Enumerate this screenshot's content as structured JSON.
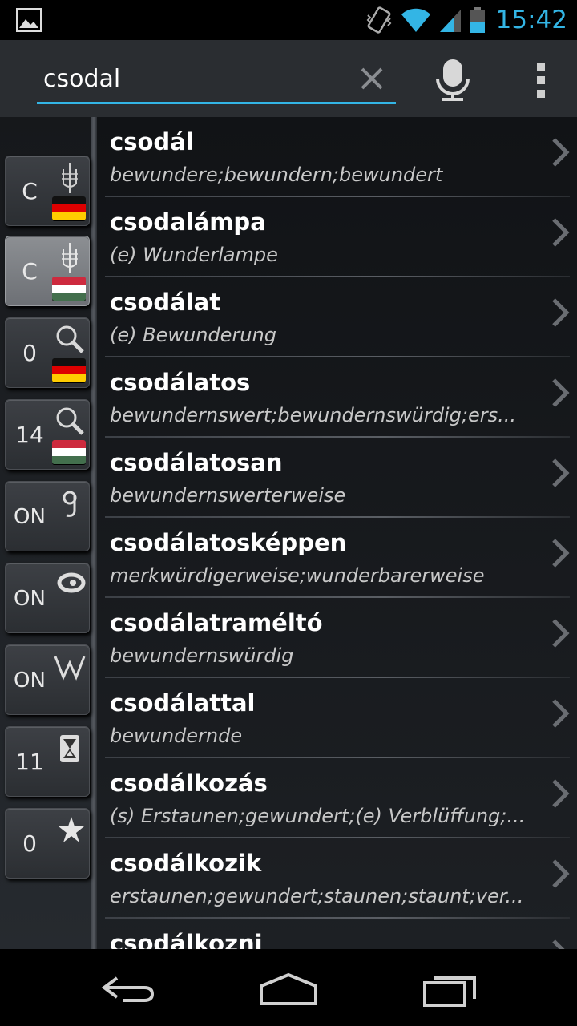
{
  "status": {
    "time": "15:42"
  },
  "search": {
    "query": "csodal"
  },
  "left_buttons": [
    {
      "label": "C",
      "icon": "tuning-fork-icon",
      "flag": "de"
    },
    {
      "label": "C",
      "icon": "tuning-fork-icon",
      "flag": "hu",
      "active": true
    },
    {
      "label": "0",
      "icon": "search-icon",
      "flag": "de"
    },
    {
      "label": "14",
      "icon": "search-icon",
      "flag": "hu"
    },
    {
      "label": "ON",
      "icon": "google-icon",
      "flag": ""
    },
    {
      "label": "ON",
      "icon": "bing-icon",
      "flag": ""
    },
    {
      "label": "ON",
      "icon": "wikipedia-icon",
      "flag": ""
    },
    {
      "label": "11",
      "icon": "hourglass-icon",
      "flag": ""
    },
    {
      "label": "0",
      "icon": "star-icon",
      "flag": ""
    }
  ],
  "results": [
    {
      "word": "csodál",
      "translation": "bewundere;bewundern;bewundert"
    },
    {
      "word": "csodalámpa",
      "translation": "(e) Wunderlampe"
    },
    {
      "word": "csodálat",
      "translation": "(e) Bewunderung"
    },
    {
      "word": "csodálatos",
      "translation": "bewundernswert;bewundernswürdig;ers..."
    },
    {
      "word": "csodálatosan",
      "translation": "bewundernswerterweise"
    },
    {
      "word": "csodálatosképpen",
      "translation": "merkwürdigerweise;wunderbarerweise"
    },
    {
      "word": "csodálatraméltó",
      "translation": "bewundernswürdig"
    },
    {
      "word": "csodálattal",
      "translation": "bewundernde"
    },
    {
      "word": "csodálkozás",
      "translation": "(s) Erstaunen;gewundert;(e) Verblüffung;..."
    },
    {
      "word": "csodálkozik",
      "translation": "erstaunen;gewundert;staunen;staunt;ver..."
    },
    {
      "word": "csodálkozni",
      "translation": ""
    }
  ],
  "colors": {
    "accent": "#33b5e5",
    "background": "#1b1e22"
  }
}
